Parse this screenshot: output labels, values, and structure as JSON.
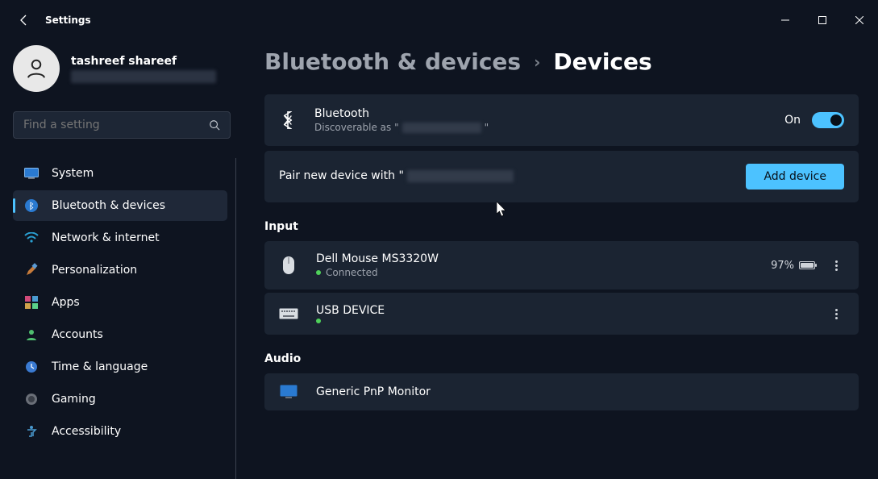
{
  "window": {
    "title": "Settings"
  },
  "account": {
    "name": "tashreef shareef"
  },
  "search": {
    "placeholder": "Find a setting"
  },
  "nav": {
    "items": [
      {
        "label": "System"
      },
      {
        "label": "Bluetooth & devices"
      },
      {
        "label": "Network & internet"
      },
      {
        "label": "Personalization"
      },
      {
        "label": "Apps"
      },
      {
        "label": "Accounts"
      },
      {
        "label": "Time & language"
      },
      {
        "label": "Gaming"
      },
      {
        "label": "Accessibility"
      }
    ]
  },
  "breadcrumb": {
    "parent": "Bluetooth & devices",
    "current": "Devices"
  },
  "bluetooth": {
    "title": "Bluetooth",
    "subtitle_prefix": "Discoverable as \"",
    "subtitle_suffix": "\"",
    "state_label": "On"
  },
  "pair": {
    "text_prefix": "Pair new device with \"",
    "button": "Add device"
  },
  "sections": {
    "input": "Input",
    "audio": "Audio"
  },
  "devices": {
    "input": [
      {
        "name": "Dell Mouse MS3320W",
        "status": "Connected",
        "battery": "97%"
      },
      {
        "name": "USB DEVICE",
        "status": ""
      }
    ],
    "audio": [
      {
        "name": "Generic PnP Monitor",
        "status": ""
      }
    ]
  }
}
